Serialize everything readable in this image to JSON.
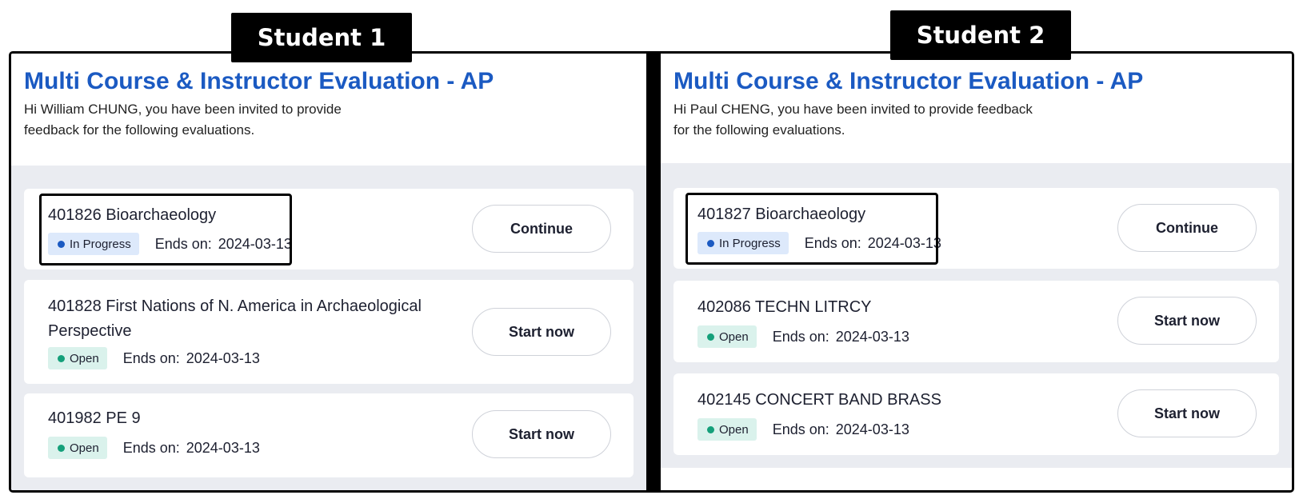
{
  "labels": {
    "student1": "Student 1",
    "student2": "Student 2"
  },
  "panels": [
    {
      "title": "Multi Course & Instructor Evaluation - AP",
      "subtitle": "Hi William CHUNG, you have been invited to provide feedback for the following evaluations.",
      "ends_label": "Ends on:",
      "items": [
        {
          "course": "401826 Bioarchaeology",
          "status": "In Progress",
          "ends_on": "2024-03-13",
          "action": "Continue"
        },
        {
          "course": "401828 First Nations of N. America in Archaeological Perspective",
          "status": "Open",
          "ends_on": "2024-03-13",
          "action": "Start now"
        },
        {
          "course": "401982 PE 9",
          "status": "Open",
          "ends_on": "2024-03-13",
          "action": "Start now"
        }
      ]
    },
    {
      "title": "Multi Course & Instructor Evaluation - AP",
      "subtitle": "Hi Paul CHENG, you have been invited to provide feedback for the following evaluations.",
      "ends_label": "Ends on:",
      "items": [
        {
          "course": "401827 Bioarchaeology",
          "status": "In Progress",
          "ends_on": "2024-03-13",
          "action": "Continue"
        },
        {
          "course": "402086 TECHN LITRCY",
          "status": "Open",
          "ends_on": "2024-03-13",
          "action": "Start now"
        },
        {
          "course": "402145 CONCERT BAND BRASS",
          "status": "Open",
          "ends_on": "2024-03-13",
          "action": "Start now"
        }
      ]
    }
  ],
  "colors": {
    "title": "#1b5ac2",
    "in_progress_badge": "#dde9fb",
    "open_badge": "#daf2ec",
    "list_background": "#eaecf1"
  }
}
